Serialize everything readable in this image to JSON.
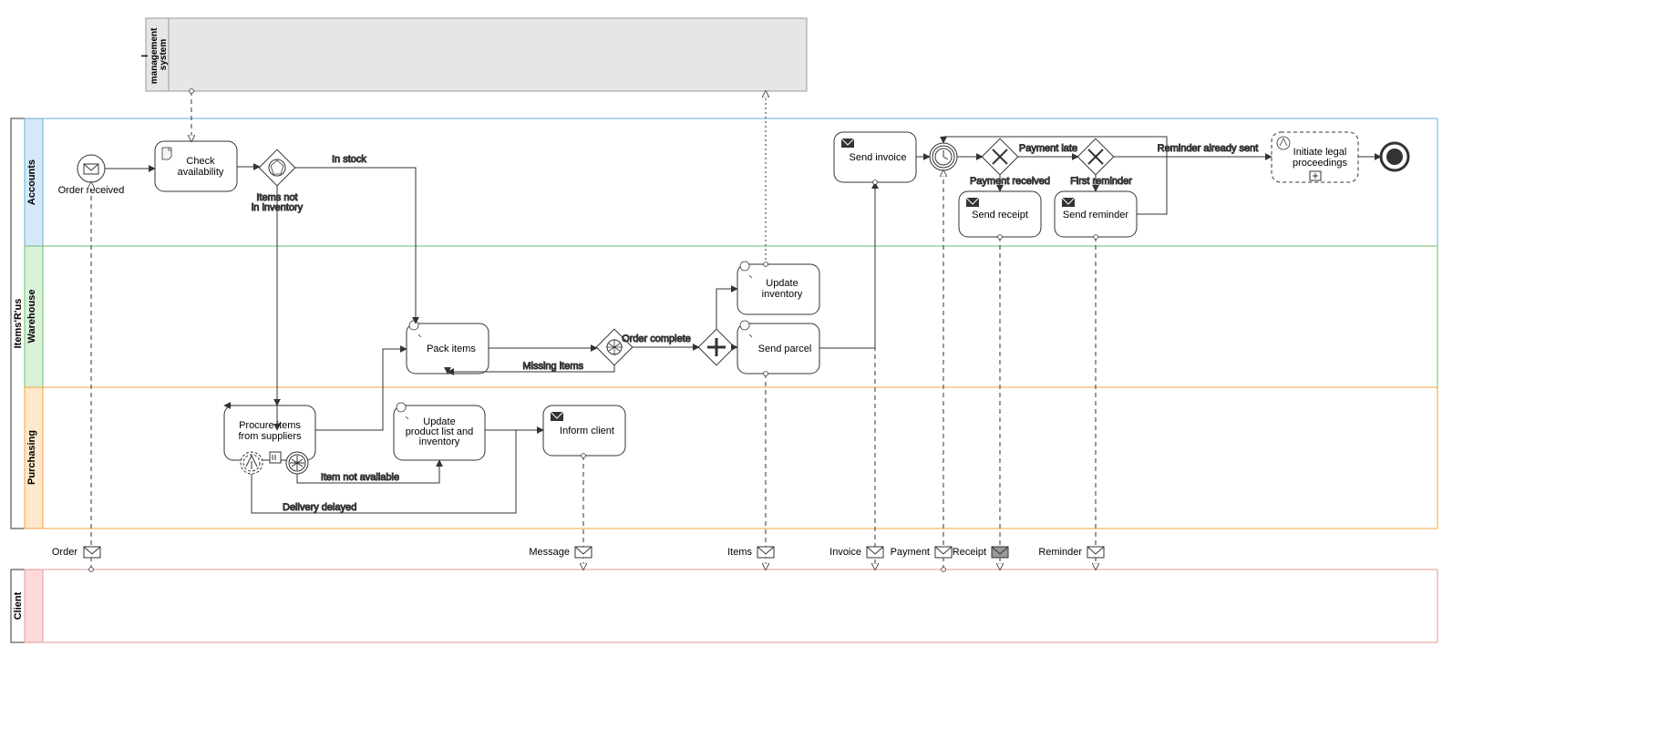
{
  "pools": {
    "inventory_system": "Inventory\nmanagement\nsystem",
    "main": "Items'R'us",
    "client": "Client"
  },
  "lanes": {
    "accounts": "Accounts",
    "warehouse": "Warehouse",
    "purchasing": "Purchasing"
  },
  "events": {
    "order_received": "Order received"
  },
  "tasks": {
    "check_availability": "Check\navailability",
    "pack_items": "Pack items",
    "procure_items": "Procure items\nfrom suppliers",
    "update_product_list": "Update\nproduct list and\ninventory",
    "inform_client": "Inform client",
    "update_inventory": "Update\ninventory",
    "send_parcel": "Send parcel",
    "send_invoice": "Send invoice",
    "send_receipt": "Send receipt",
    "send_reminder": "Send reminder",
    "initiate_legal": "Initiate legal\nproceedings"
  },
  "labels": {
    "in_stock": "In stock",
    "items_not_in_inventory": "Items not\nin inventory",
    "order_complete": "Order complete",
    "missing_items": "Missing items",
    "item_not_available": "Item not available",
    "delivery_delayed": "Delivery delayed",
    "payment_received": "Payment received",
    "payment_late": "Payment late",
    "first_reminder": "First reminder",
    "reminder_already_sent": "Reminder already sent"
  },
  "messages": {
    "order": "Order",
    "message": "Message",
    "items": "Items",
    "invoice": "Invoice",
    "payment": "Payment",
    "receipt": "Receipt",
    "reminder": "Reminder"
  }
}
